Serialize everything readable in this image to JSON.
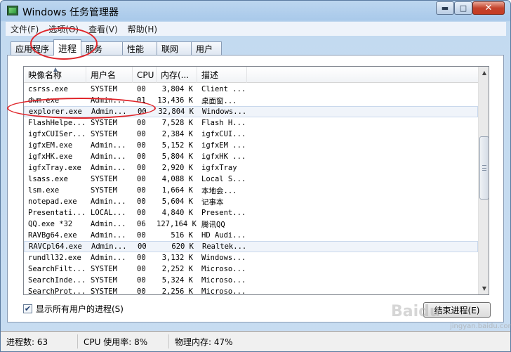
{
  "window": {
    "title": "Windows 任务管理器",
    "buttons": {
      "minimize": "▬",
      "maximize": "□",
      "close": "✕"
    }
  },
  "menu": [
    "文件(F)",
    "选项(O)",
    "查看(V)",
    "帮助(H)"
  ],
  "tabs": [
    {
      "label": "应用程序",
      "active": false
    },
    {
      "label": "进程",
      "active": true
    },
    {
      "label": "服务",
      "active": false
    },
    {
      "label": "性能",
      "active": false
    },
    {
      "label": "联网",
      "active": false
    },
    {
      "label": "用户",
      "active": false
    }
  ],
  "columns": [
    "映像名称",
    "用户名",
    "CPU",
    "内存(...",
    "描述"
  ],
  "sort_arrow": "▲",
  "processes": [
    {
      "name": "csrss.exe",
      "user": "SYSTEM",
      "cpu": "00",
      "mem": "3,804 K",
      "desc": "Client ..."
    },
    {
      "name": "dwm.exe",
      "user": "Admin...",
      "cpu": "01",
      "mem": "13,436 K",
      "desc": "桌面窗..."
    },
    {
      "name": "explorer.exe",
      "user": "Admin...",
      "cpu": "00",
      "mem": "32,804 K",
      "desc": "Windows..."
    },
    {
      "name": "FlashHelpe...",
      "user": "SYSTEM",
      "cpu": "00",
      "mem": "7,528 K",
      "desc": "Flash H..."
    },
    {
      "name": "igfxCUISer...",
      "user": "SYSTEM",
      "cpu": "00",
      "mem": "2,384 K",
      "desc": "igfxCUI..."
    },
    {
      "name": "igfxEM.exe",
      "user": "Admin...",
      "cpu": "00",
      "mem": "5,152 K",
      "desc": "igfxEM ..."
    },
    {
      "name": "igfxHK.exe",
      "user": "Admin...",
      "cpu": "00",
      "mem": "5,804 K",
      "desc": "igfxHK ..."
    },
    {
      "name": "igfxTray.exe",
      "user": "Admin...",
      "cpu": "00",
      "mem": "2,920 K",
      "desc": "igfxTray"
    },
    {
      "name": "lsass.exe",
      "user": "SYSTEM",
      "cpu": "00",
      "mem": "4,088 K",
      "desc": "Local S..."
    },
    {
      "name": "lsm.exe",
      "user": "SYSTEM",
      "cpu": "00",
      "mem": "1,664 K",
      "desc": "本地会..."
    },
    {
      "name": "notepad.exe",
      "user": "Admin...",
      "cpu": "00",
      "mem": "5,604 K",
      "desc": "记事本"
    },
    {
      "name": "Presentati...",
      "user": "LOCAL...",
      "cpu": "00",
      "mem": "4,840 K",
      "desc": "Present..."
    },
    {
      "name": "QQ.exe *32",
      "user": "Admin...",
      "cpu": "06",
      "mem": "127,164 K",
      "desc": "腾讯QQ"
    },
    {
      "name": "RAVBg64.exe",
      "user": "Admin...",
      "cpu": "00",
      "mem": "516 K",
      "desc": "HD Audi..."
    },
    {
      "name": "RAVCpl64.exe",
      "user": "Admin...",
      "cpu": "00",
      "mem": "620 K",
      "desc": "Realtek..."
    },
    {
      "name": "rundll32.exe",
      "user": "Admin...",
      "cpu": "00",
      "mem": "3,132 K",
      "desc": "Windows..."
    },
    {
      "name": "SearchFilt...",
      "user": "SYSTEM",
      "cpu": "00",
      "mem": "2,252 K",
      "desc": "Microso..."
    },
    {
      "name": "SearchInde...",
      "user": "SYSTEM",
      "cpu": "00",
      "mem": "5,324 K",
      "desc": "Microso..."
    },
    {
      "name": "SearchProt...",
      "user": "SYSTEM",
      "cpu": "00",
      "mem": "2,256 K",
      "desc": "Microso..."
    }
  ],
  "highlighted_rows": [
    2,
    14
  ],
  "show_all_users": {
    "label": "显示所有用户的进程(S)",
    "checked": true,
    "check_glyph": "✔"
  },
  "end_process_button": "结束进程(E)",
  "scrollbar": {
    "up": "▲",
    "down": "▼"
  },
  "status": {
    "processes": "进程数: 63",
    "cpu": "CPU 使用率: 8%",
    "memory": "物理内存: 47%"
  },
  "watermark": {
    "text": "Baidu",
    "sub": "jingyan.baidu.com"
  },
  "colors": {
    "annotation": "#e0262b",
    "close_button": "#c53b22"
  }
}
